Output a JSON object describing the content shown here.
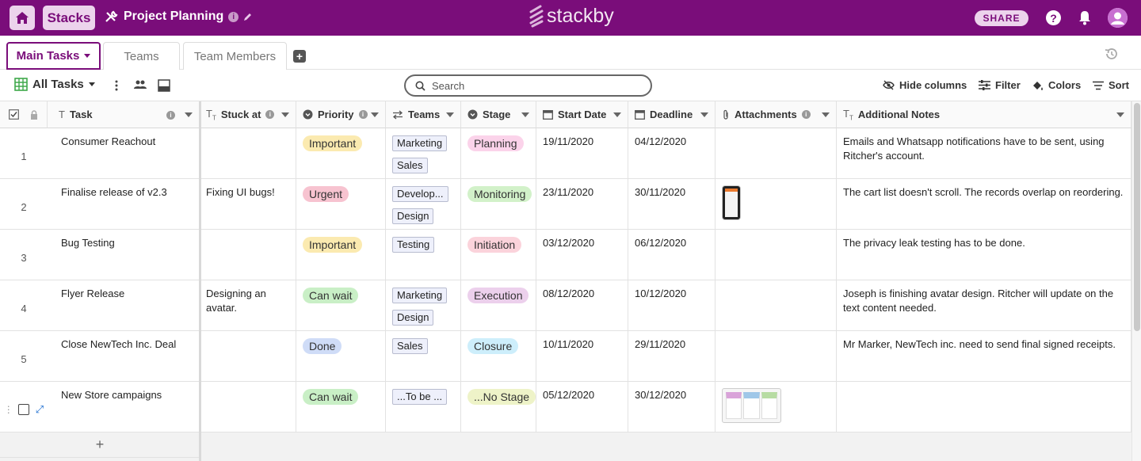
{
  "topbar": {
    "stacks_label": "Stacks",
    "project_title": "Project Planning",
    "logo_text": "stackby",
    "share_label": "SHARE",
    "brand_color": "#7a0d7a"
  },
  "tabs": [
    {
      "label": "Main Tasks",
      "active": true
    },
    {
      "label": "Teams",
      "active": false
    },
    {
      "label": "Team Members",
      "active": false
    }
  ],
  "add_tab_label": "+",
  "toolbar": {
    "view_label": "All Tasks",
    "search_placeholder": "Search",
    "hide_columns": "Hide columns",
    "filter": "Filter",
    "colors": "Colors",
    "sort": "Sort"
  },
  "columns": {
    "task": "Task",
    "stuck_at": "Stuck at",
    "priority": "Priority",
    "teams": "Teams",
    "stage": "Stage",
    "start_date": "Start Date",
    "deadline": "Deadline",
    "attachments": "Attachments",
    "notes": "Additional Notes"
  },
  "rows": [
    {
      "num": "1",
      "task": "Consumer Reachout",
      "stuck": "",
      "priority": "Important",
      "teams": [
        "Marketing",
        "Sales"
      ],
      "stage": "Planning",
      "start": "19/11/2020",
      "deadline": "04/12/2020",
      "notes": "Emails and Whatsapp notifications have to be sent, using Ritcher's account."
    },
    {
      "num": "2",
      "task": "Finalise release of v2.3",
      "stuck": "Fixing UI bugs!",
      "priority": "Urgent",
      "teams": [
        "Develop...",
        "Design"
      ],
      "stage": "Monitoring",
      "start": "23/11/2020",
      "deadline": "30/11/2020",
      "notes": "The cart list doesn't scroll. The records overlap on reordering."
    },
    {
      "num": "3",
      "task": "Bug Testing",
      "stuck": "",
      "priority": "Important",
      "teams": [
        "Testing"
      ],
      "stage": "Initiation",
      "start": "03/12/2020",
      "deadline": "06/12/2020",
      "notes": "The privacy leak testing has to be done."
    },
    {
      "num": "4",
      "task": "Flyer Release",
      "stuck": "Designing an avatar.",
      "priority": "Can wait",
      "teams": [
        "Marketing",
        "Design"
      ],
      "stage": "Execution",
      "start": "08/12/2020",
      "deadline": "10/12/2020",
      "notes": "Joseph is finishing avatar design. Ritcher will update on the text content needed."
    },
    {
      "num": "5",
      "task": "Close NewTech Inc. Deal",
      "stuck": "",
      "priority": "Done",
      "teams": [
        "Sales"
      ],
      "stage": "Closure",
      "start": "10/11/2020",
      "deadline": "29/11/2020",
      "notes": "Mr Marker, NewTech inc. need to send final signed receipts."
    },
    {
      "num": "",
      "task": "New Store campaigns",
      "stuck": "",
      "priority": "Can wait",
      "teams": [
        "...To be ..."
      ],
      "stage": "...No Stage",
      "start": "05/12/2020",
      "deadline": "30/12/2020",
      "notes": ""
    }
  ],
  "pill_colors": {
    "Important": "#fbeab0",
    "Urgent": "#f7c3d0",
    "Can wait": "#c9efc6",
    "Done": "#cfdcf7",
    "Planning": "#fbd3ea",
    "Monitoring": "#d2f1c9",
    "Initiation": "#fbd3db",
    "Execution": "#ecd0ec",
    "Closure": "#cdeefb",
    "...No Stage": "#eef3c8"
  },
  "add_row_label": "+"
}
